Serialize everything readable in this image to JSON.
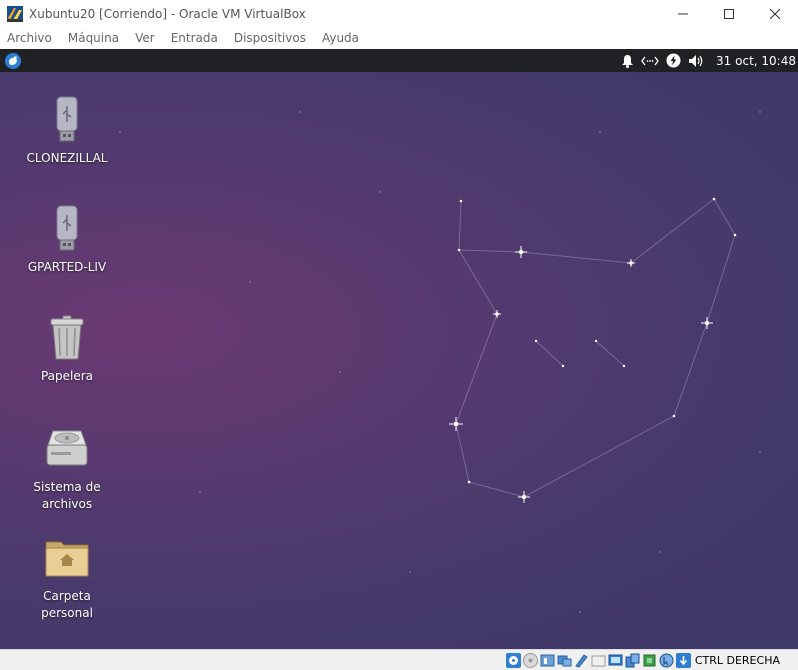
{
  "window": {
    "title": "Xubuntu20 [Corriendo] - Oracle VM VirtualBox",
    "controls": [
      "minimize",
      "maximize",
      "close"
    ]
  },
  "menubar": {
    "items": [
      "Archivo",
      "Máquina",
      "Ver",
      "Entrada",
      "Dispositivos",
      "Ayuda"
    ]
  },
  "panel": {
    "menu_icon": "xfce-mouse-icon",
    "tray_icons": [
      "bell-icon",
      "network-icon",
      "power-icon",
      "volume-icon"
    ],
    "clock": "31 oct, 10:48"
  },
  "desktop": {
    "icons": [
      {
        "label": "CLONEZILLAL",
        "icon": "usb-drive-icon"
      },
      {
        "label": "GPARTED-LIV",
        "icon": "usb-drive-icon"
      },
      {
        "label": "Papelera",
        "icon": "trash-icon"
      },
      {
        "label": "Sistema de archivos",
        "icon": "hard-drive-icon"
      },
      {
        "label": "Carpeta personal",
        "icon": "home-folder-icon"
      }
    ]
  },
  "statusbar": {
    "icons": [
      "optical-drive-icon",
      "hard-disk-icon",
      "audio-icon",
      "network-icon",
      "usb-icon",
      "shared-folders-icon",
      "display-icon",
      "video-capture-icon",
      "cpu-icon",
      "mouse-integration-icon",
      "keyboard-icon"
    ],
    "host_key": "CTRL DERECHA",
    "colors": {
      "accent": "#2e7fd4"
    }
  }
}
